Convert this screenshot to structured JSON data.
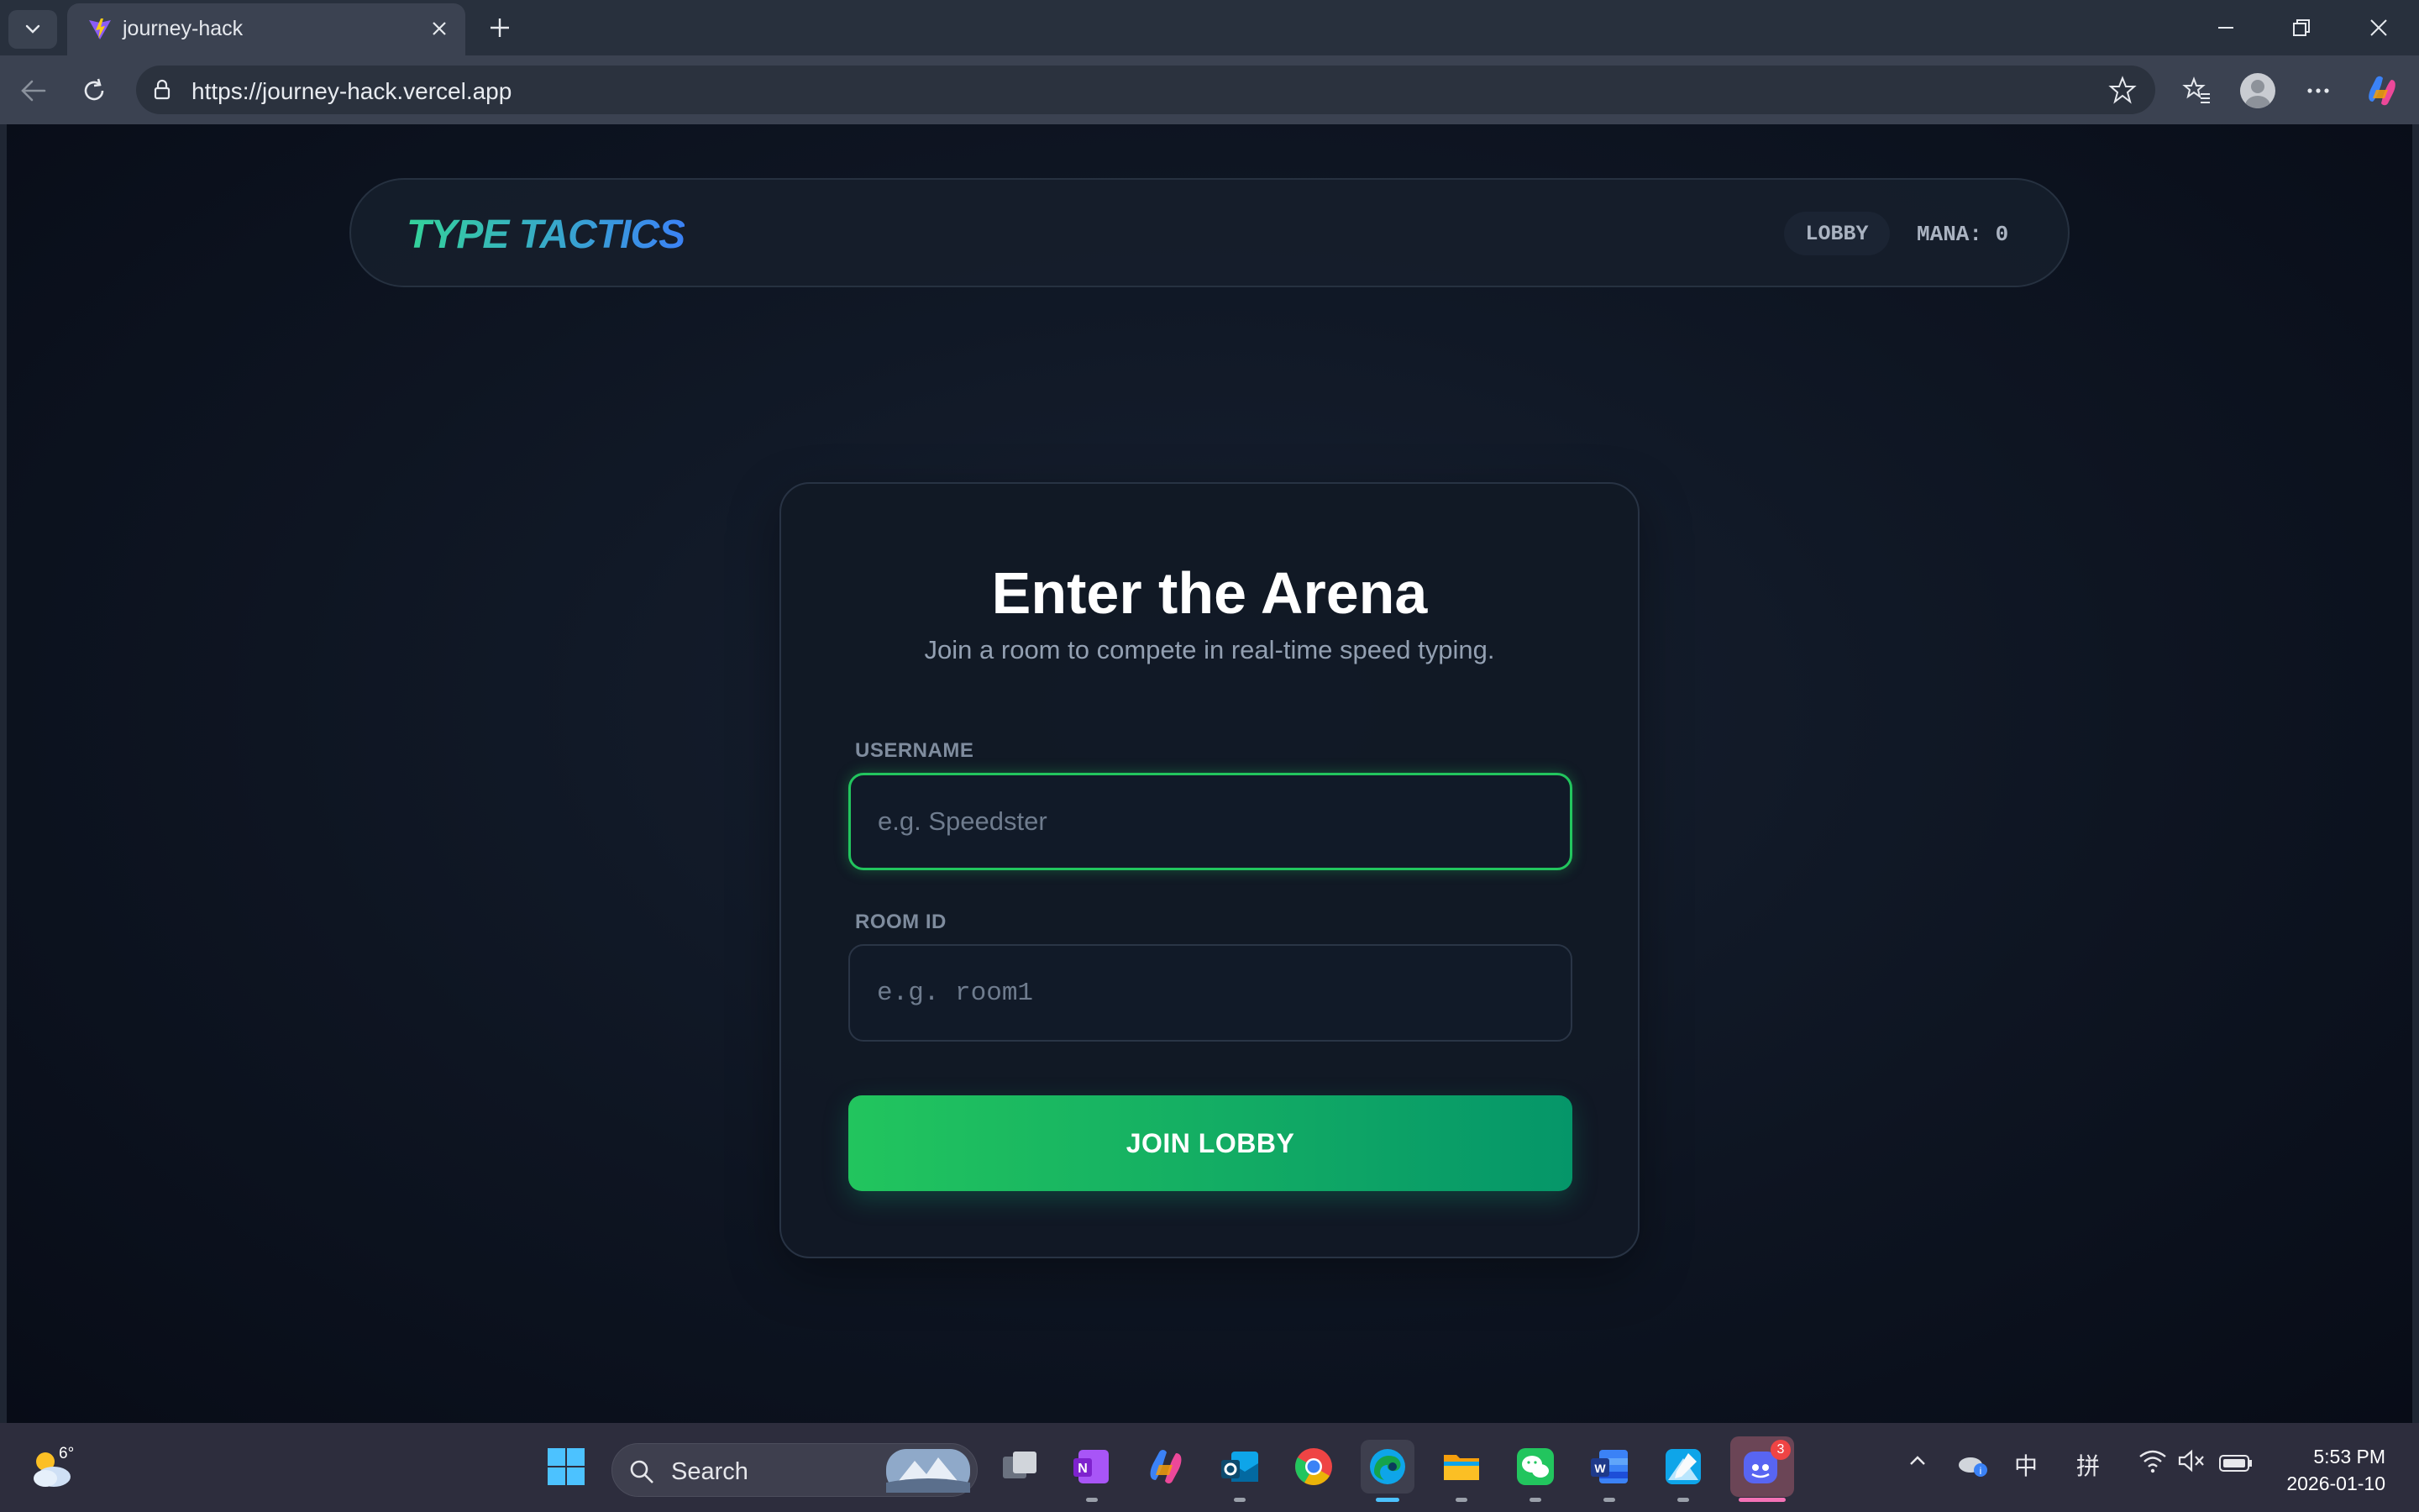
{
  "browser": {
    "tab_title": "journey-hack",
    "url": "https://journey-hack.vercel.app"
  },
  "page": {
    "brand": "TYPE TACTICS",
    "nav_pill": "LOBBY",
    "mana_label": "MANA: 0",
    "card": {
      "title": "Enter the Arena",
      "subtitle": "Join a room to compete in real-time speed typing.",
      "username_label": "USERNAME",
      "username_placeholder": "e.g. Speedster",
      "room_label": "ROOM ID",
      "room_placeholder": "e.g. room1",
      "join_button": "JOIN LOBBY"
    },
    "colors": {
      "accent_green": "#22c55e",
      "brand_gradient_start": "#34d399",
      "brand_gradient_end": "#3b82f6"
    }
  },
  "taskbar": {
    "weather_temp": "6°",
    "search_label": "Search",
    "discord_badge": "3",
    "ime_chinese": "中",
    "ime_pinyin": "拼",
    "time": "5:53 PM",
    "date": "2026-01-10",
    "apps": [
      "widgets-icon",
      "start-icon",
      "search-icon",
      "task-view-icon",
      "onenote-icon",
      "copilot-icon",
      "outlook-icon",
      "chrome-icon",
      "edge-icon",
      "file-explorer-icon",
      "wechat-icon",
      "word-icon",
      "photos-icon",
      "discord-icon"
    ]
  }
}
